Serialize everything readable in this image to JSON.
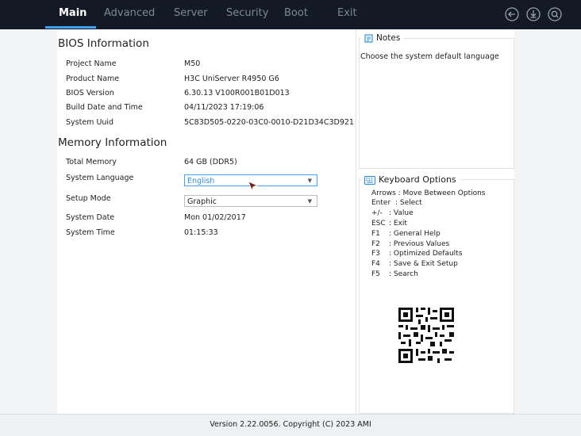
{
  "tabs": [
    {
      "label": "Main",
      "active": true
    },
    {
      "label": "Advanced",
      "active": false
    },
    {
      "label": "Server",
      "active": false
    },
    {
      "label": "Security",
      "active": false
    },
    {
      "label": "Boot",
      "active": false
    },
    {
      "label": "Exit",
      "active": false
    }
  ],
  "top_icons": [
    "back-icon",
    "save-icon",
    "search-icon"
  ],
  "bios_info": {
    "title": "BIOS Information",
    "rows": [
      {
        "label": "Project Name",
        "value": "M50"
      },
      {
        "label": "Product Name",
        "value": "H3C UniServer R4950 G6"
      },
      {
        "label": "BIOS Version",
        "value": "6.30.13 V100R001B01D013"
      },
      {
        "label": "Build Date and Time",
        "value": "04/11/2023 17:19:06"
      },
      {
        "label": "System Uuid",
        "value": "5C83D505-0220-03C0-0010-D21D34C3D921"
      }
    ]
  },
  "memory_info": {
    "title": "Memory Information",
    "total_memory_label": "Total Memory",
    "total_memory_value": "64 GB (DDR5)",
    "system_language_label": "System Language",
    "system_language_value": "English",
    "setup_mode_label": "Setup Mode",
    "setup_mode_value": "Graphic",
    "system_date_label": "System Date",
    "system_date_value": "Mon 01/02/2017",
    "system_time_label": "System Time",
    "system_time_value": "01:15:33"
  },
  "notes": {
    "title": "Notes",
    "text": "Choose the system default language"
  },
  "keyboard": {
    "title": "Keyboard Options",
    "lines": [
      {
        "key": "Arrows",
        "desc": ": Move Between Options"
      },
      {
        "key": "Enter",
        "desc": ": Select"
      },
      {
        "key": "+/-",
        "desc": ": Value"
      },
      {
        "key": "ESC",
        "desc": ": Exit"
      },
      {
        "key": "F1",
        "desc": ": General Help"
      },
      {
        "key": "F2",
        "desc": ": Previous Values"
      },
      {
        "key": "F3",
        "desc": ": Optimized Defaults"
      },
      {
        "key": "F4",
        "desc": ": Save & Exit Setup"
      },
      {
        "key": "F5",
        "desc": ": Search"
      }
    ]
  },
  "footer": "Version 2.22.0056. Copyright (C) 2023 AMI",
  "colors": {
    "topbar": "#131a25",
    "accent": "#3ea0ff",
    "tab_inactive": "#7f8792"
  }
}
